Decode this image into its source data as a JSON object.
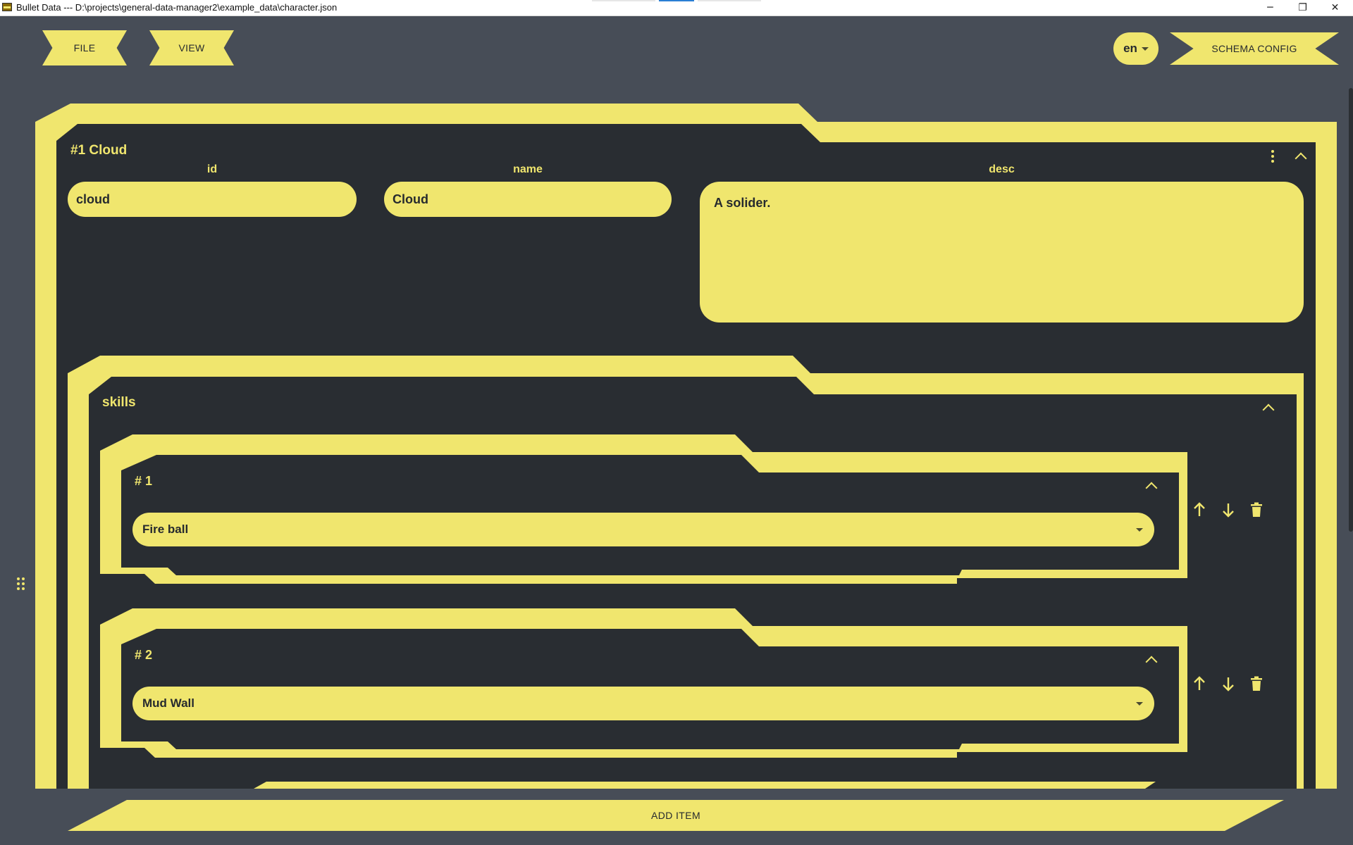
{
  "window": {
    "title": "Bullet Data --- D:\\projects\\general-data-manager2\\example_data\\character.json",
    "minimize_glyph": "─",
    "restore_glyph": "❐",
    "close_glyph": "✕"
  },
  "toolbar": {
    "file_label": "FILE",
    "view_label": "VIEW",
    "language": "en",
    "schema_label": "SCHEMA CONFIG"
  },
  "record": {
    "title": "#1 Cloud",
    "fields": {
      "id": {
        "label": "id",
        "value": "cloud"
      },
      "name": {
        "label": "name",
        "value": "Cloud"
      },
      "desc": {
        "label": "desc",
        "value": "A solider."
      }
    },
    "skills": {
      "label": "skills",
      "items": [
        {
          "label": "# 1",
          "value": "Fire ball"
        },
        {
          "label": "# 2",
          "value": "Mud Wall"
        }
      ]
    }
  },
  "footer": {
    "add_item_label": "ADD ITEM"
  },
  "colors": {
    "accent": "#f0e66e",
    "panel": "#292d32",
    "background": "#474d57",
    "text_dark": "#262a2e"
  },
  "icons": [
    "more-vert-icon",
    "chevron-up-icon",
    "arrow-up-icon",
    "arrow-down-icon",
    "trash-icon",
    "drag-handle-icon",
    "dropdown-caret-icon"
  ]
}
